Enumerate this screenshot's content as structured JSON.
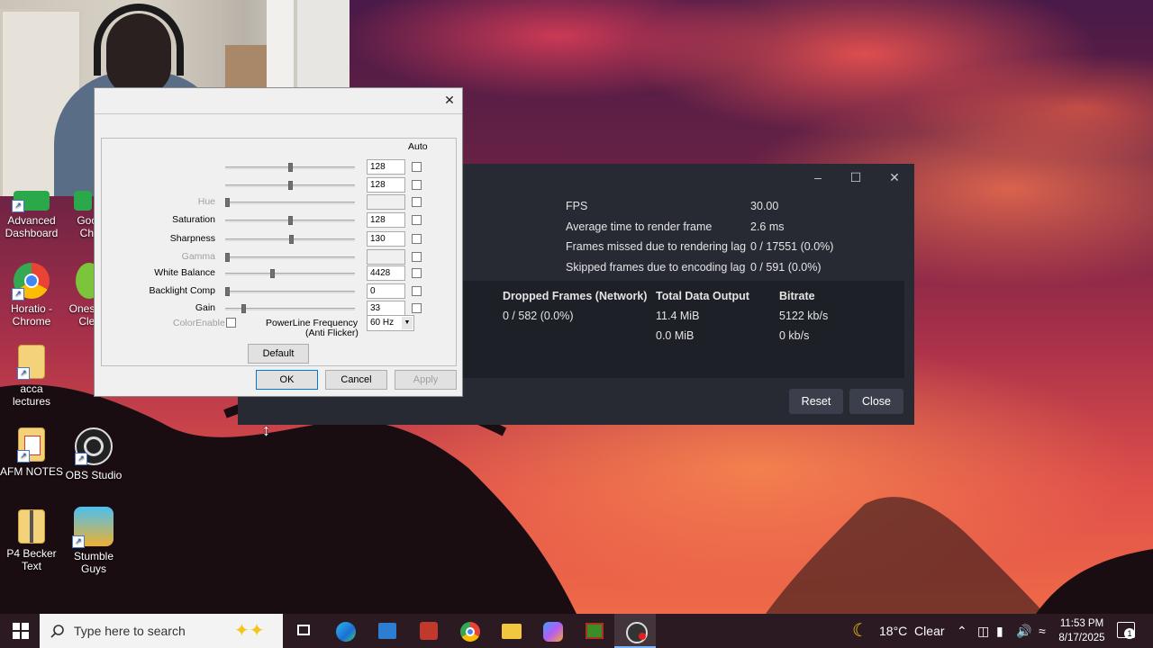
{
  "desktop_icons": [
    {
      "name": "advanced-dashboard",
      "label": "Advanced\nDashboard"
    },
    {
      "name": "google-chrome",
      "label": "Goo\nChr"
    },
    {
      "name": "horatio-chrome",
      "label": "Horatio -\nChrome"
    },
    {
      "name": "onesa",
      "label": "Onesa\nClea"
    },
    {
      "name": "acca-lectures",
      "label": "acca lectures"
    },
    {
      "name": "afm-notes",
      "label": "AFM NOTES"
    },
    {
      "name": "obs-studio",
      "label": "OBS Studio"
    },
    {
      "name": "p4-becker-text",
      "label": "P4 Becker\nText"
    },
    {
      "name": "stumble-guys",
      "label": "Stumble\nGuys"
    }
  ],
  "stats": {
    "rows": [
      {
        "label": "FPS",
        "value": "30.00"
      },
      {
        "label": "Average time to render frame",
        "value": "2.6 ms"
      },
      {
        "label": "Frames missed due to rendering lag",
        "value": "0 / 17551 (0.0%)"
      },
      {
        "label": "Skipped frames due to encoding lag",
        "value": "0 / 591 (0.0%)"
      }
    ],
    "columns": [
      "Dropped Frames (Network)",
      "Total Data Output",
      "Bitrate"
    ],
    "outputs": [
      {
        "dropped": "0 / 582 (0.0%)",
        "total": "11.4 MiB",
        "bitrate": "5122 kb/s"
      },
      {
        "dropped": "",
        "total": "0.0 MiB",
        "bitrate": "0 kb/s"
      }
    ],
    "reset_label": "Reset",
    "close_label": "Close"
  },
  "camera_dialog": {
    "auto_header": "Auto",
    "props": [
      {
        "label": "",
        "value": "128",
        "pos": 0.5,
        "enabled": true
      },
      {
        "label": "",
        "value": "128",
        "pos": 0.5,
        "enabled": true
      },
      {
        "label": "Hue",
        "value": "",
        "pos": 0.0,
        "enabled": false
      },
      {
        "label": "Saturation",
        "value": "128",
        "pos": 0.5,
        "enabled": true
      },
      {
        "label": "Sharpness",
        "value": "130",
        "pos": 0.51,
        "enabled": true
      },
      {
        "label": "Gamma",
        "value": "",
        "pos": 0.0,
        "enabled": false
      },
      {
        "label": "White Balance",
        "value": "4428",
        "pos": 0.36,
        "enabled": true
      },
      {
        "label": "Backlight Comp",
        "value": "0",
        "pos": 0.0,
        "enabled": true
      },
      {
        "label": "Gain",
        "value": "33",
        "pos": 0.13,
        "enabled": true
      }
    ],
    "color_enable_label": "ColorEnable",
    "powerline_label": "PowerLine Frequency",
    "powerline_sub": "(Anti Flicker)",
    "powerline_value": "60 Hz",
    "default_label": "Default",
    "ok_label": "OK",
    "cancel_label": "Cancel",
    "apply_label": "Apply"
  },
  "taskbar": {
    "search_placeholder": "Type here to search",
    "weather": "18°C  Clear",
    "time": "11:53 PM",
    "date": "8/17/2025",
    "notification_count": "1"
  }
}
